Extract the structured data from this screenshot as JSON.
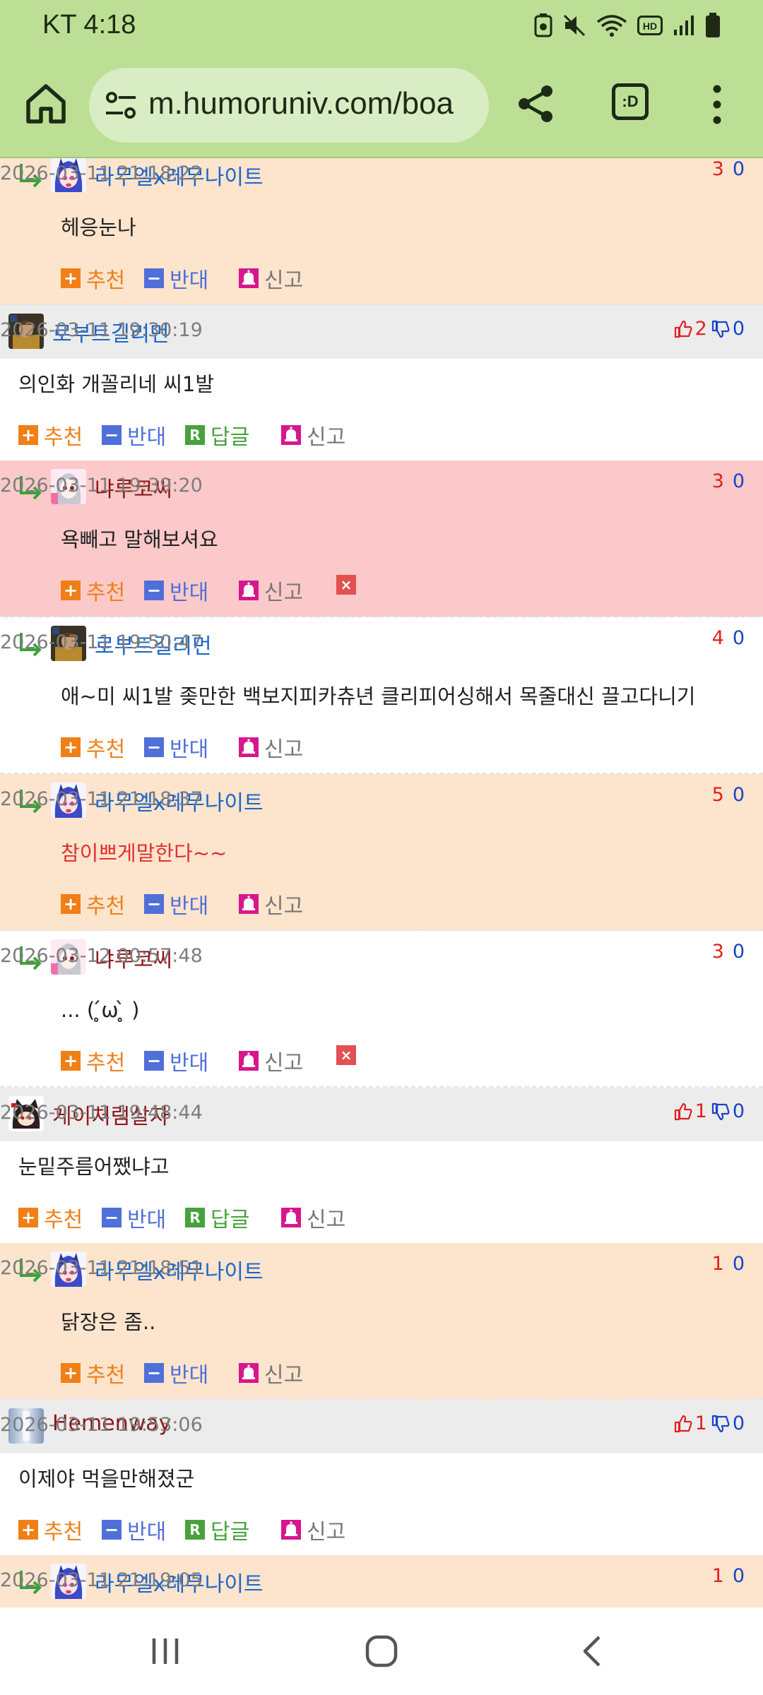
{
  "status": {
    "time": "KT 4:18"
  },
  "browser": {
    "url": "m.humoruniv.com/boa",
    "tabs_label": ":D"
  },
  "labels": {
    "up": "추천",
    "down": "반대",
    "reply": "답글",
    "report": "신고"
  },
  "comments": [
    {
      "kind": "reply",
      "bg": "peach",
      "nick": "라무엘x레무나이트",
      "nick_color": "blue",
      "date": "2026-03-11 21:18:22",
      "up": "3",
      "down": "0",
      "text": "헤응눈나",
      "avatar": "blue-hair"
    },
    {
      "kind": "top",
      "nick": "로부트길리먼",
      "nick_color": "blue",
      "date": "2026-03-11 19:30:19",
      "up": "2",
      "down": "0",
      "text": "의인화 개꼴리네 씨1발",
      "avatar": "armor"
    },
    {
      "kind": "reply",
      "bg": "pink",
      "nick": "냐루코씨",
      "nick_color": "maroon",
      "date": "2026-03-11 19:39:20",
      "up": "3",
      "down": "0",
      "text": "욕빼고 말해보셔요",
      "avatar": "silver-hair",
      "deletable": true
    },
    {
      "kind": "reply",
      "bg": "white",
      "nick": "로부트길리먼",
      "nick_color": "blue",
      "date": "2026-03-11 19:50:47",
      "up": "4",
      "down": "0",
      "text": "애~미 씨1발 좆만한 백보지피카츄년 클리피어싱해서 목줄대신 끌고다니기",
      "avatar": "armor"
    },
    {
      "kind": "reply",
      "bg": "peach",
      "nick": "라무엘x레무나이트",
      "nick_color": "blue",
      "date": "2026-03-11 21:18:37",
      "up": "5",
      "down": "0",
      "text": "참이쁘게말한다~~",
      "text_color": "red",
      "avatar": "blue-hair"
    },
    {
      "kind": "reply",
      "bg": "white",
      "nick": "냐루코씨",
      "nick_color": "maroon",
      "date": "2026-03-12 00:57:48",
      "up": "3",
      "down": "0",
      "text": "... ( ̥́ω ̥̀ )",
      "avatar": "silver-hair",
      "deletable": true
    },
    {
      "kind": "top",
      "nick": "게이처럼살자",
      "nick_color": "maroon",
      "date": "2026-03-11 19:48:44",
      "up": "1",
      "down": "0",
      "text": "눈밑주름어쨌냐고",
      "avatar": "dark-cat"
    },
    {
      "kind": "reply",
      "bg": "peach",
      "nick": "라무엘x레무나이트",
      "nick_color": "blue",
      "date": "2026-03-11 21:18:51",
      "up": "1",
      "down": "0",
      "text": "닭장은 좀..",
      "avatar": "blue-hair"
    },
    {
      "kind": "top",
      "nick": "Hemenway",
      "nick_color": "maroon",
      "date": "2026-03-11 19:53:06",
      "up": "1",
      "down": "0",
      "text": "이제야 먹을만해졌군",
      "avatar": "blur"
    },
    {
      "kind": "reply",
      "bg": "peach",
      "nick": "라무엘x레무나이트",
      "nick_color": "blue",
      "date": "2026-03-11 21:19:05",
      "up": "1",
      "down": "0",
      "text": "",
      "avatar": "blue-hair"
    }
  ],
  "colors": {
    "chrome": "#bcdf95",
    "reply_peach": "#fde4cd",
    "reply_pink": "#fbc9c9",
    "top_header": "#ececec"
  },
  "icons": [
    "home-icon",
    "tune-icon",
    "share-icon",
    "tabs-icon",
    "more-vert-icon",
    "recents-icon",
    "home-nav-icon",
    "back-icon"
  ]
}
